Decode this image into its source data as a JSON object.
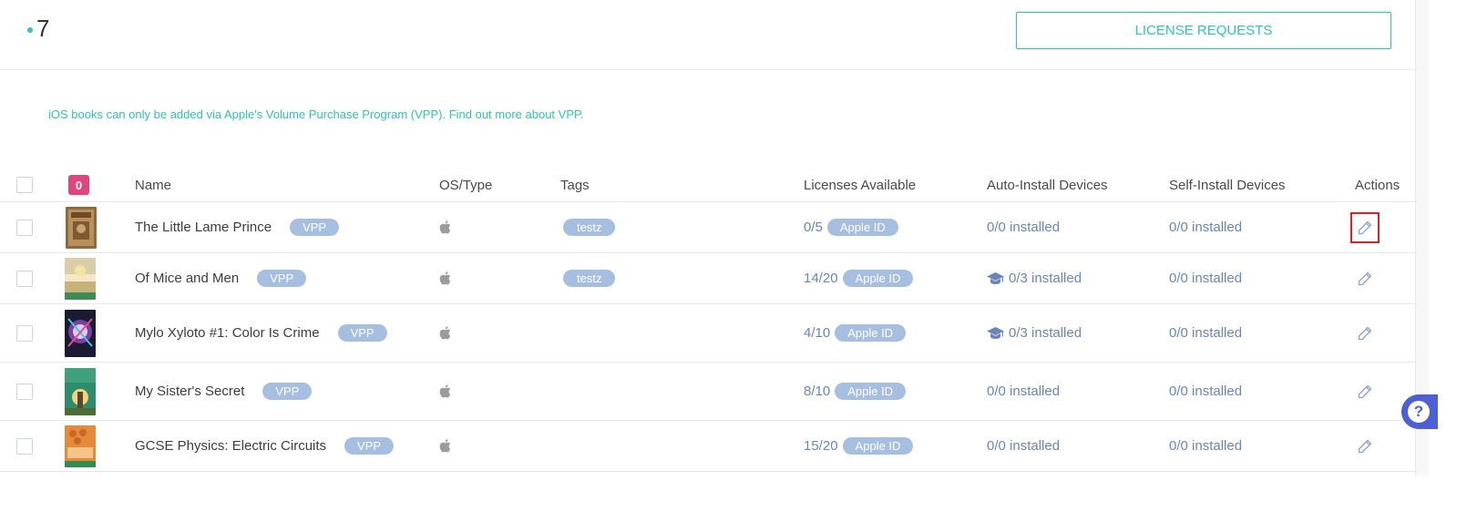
{
  "header": {
    "count": "7",
    "license_button": "LICENSE REQUESTS"
  },
  "notice": {
    "text": "iOS books can only be added via Apple's Volume Purchase Program (VPP).",
    "link": "Find out more about VPP."
  },
  "table": {
    "selected_count": "0",
    "columns": {
      "name": "Name",
      "os_type": "OS/Type",
      "tags": "Tags",
      "licenses": "Licenses Available",
      "auto_install": "Auto-Install Devices",
      "self_install": "Self-Install Devices",
      "actions": "Actions"
    },
    "rows": [
      {
        "name": "The Little Lame Prince",
        "badge": "VPP",
        "tag": "testz",
        "licenses": "0/5",
        "license_type": "Apple ID",
        "auto_install": "0/0 installed",
        "self_install": "0/0 installed"
      },
      {
        "name": "Of Mice and Men",
        "badge": "VPP",
        "tag": "testz",
        "licenses": "14/20",
        "license_type": "Apple ID",
        "auto_install": "0/3 installed",
        "self_install": "0/0 installed"
      },
      {
        "name": "Mylo Xyloto #1: Color Is Crime",
        "badge": "VPP",
        "tag": "",
        "licenses": "4/10",
        "license_type": "Apple ID",
        "auto_install": "0/3 installed",
        "self_install": "0/0 installed"
      },
      {
        "name": "My Sister's Secret",
        "badge": "VPP",
        "tag": "",
        "licenses": "8/10",
        "license_type": "Apple ID",
        "auto_install": "0/0 installed",
        "self_install": "0/0 installed"
      },
      {
        "name": "GCSE Physics: Electric Circuits",
        "badge": "VPP",
        "tag": "",
        "licenses": "15/20",
        "license_type": "Apple ID",
        "auto_install": "0/0 installed",
        "self_install": "0/0 installed"
      }
    ]
  },
  "help": {
    "symbol": "?"
  },
  "colors": {
    "accent": "#2ec4b6",
    "badge": "#e0457b",
    "pill": "#a6bedf",
    "link": "#6b85b8",
    "highlight": "#e02020",
    "help": "#4c5fd6"
  }
}
